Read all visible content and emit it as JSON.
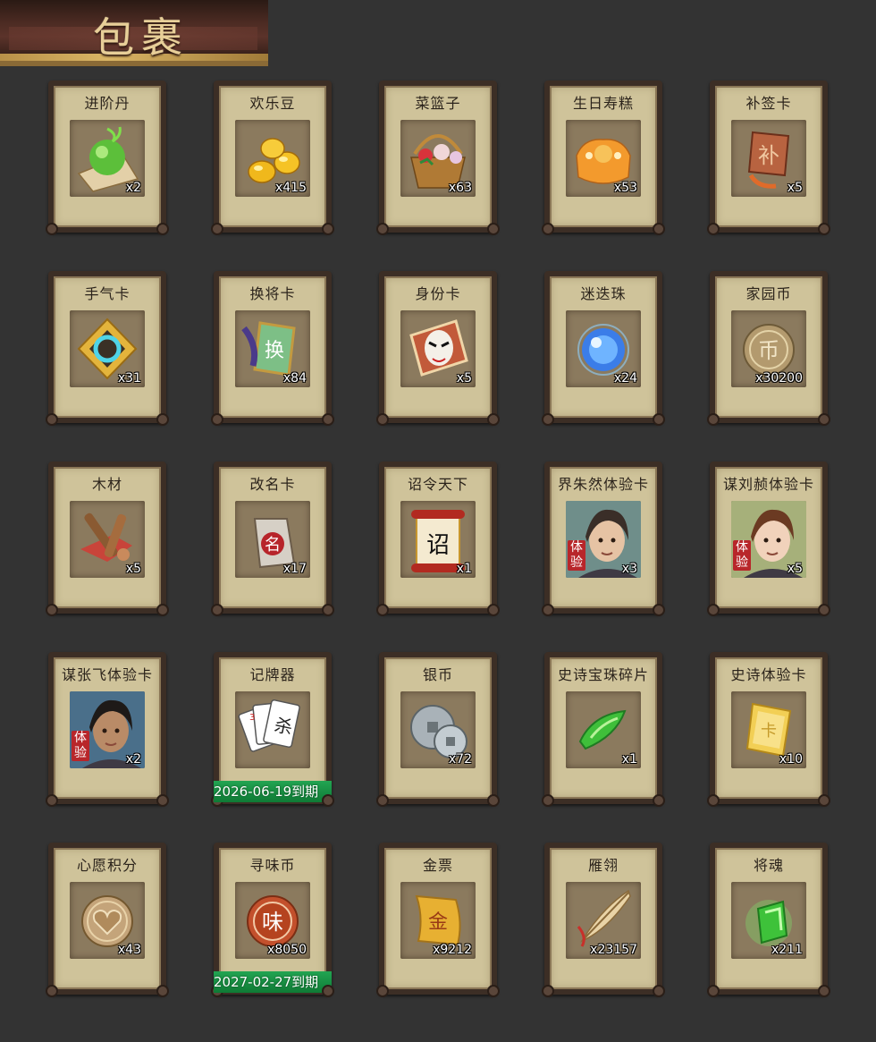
{
  "header": {
    "title": "包裹"
  },
  "items": [
    {
      "name": "进阶丹",
      "count": "x2",
      "icon": "green-orb-icon"
    },
    {
      "name": "欢乐豆",
      "count": "x415",
      "icon": "gold-beans-icon"
    },
    {
      "name": "菜篮子",
      "count": "x63",
      "icon": "flower-basket-icon"
    },
    {
      "name": "生日寿糕",
      "count": "x53",
      "icon": "birthday-cake-icon"
    },
    {
      "name": "补签卡",
      "count": "x5",
      "icon": "checkin-card-icon"
    },
    {
      "name": "手气卡",
      "count": "x31",
      "icon": "luck-card-icon"
    },
    {
      "name": "换将卡",
      "count": "x84",
      "icon": "swap-general-card-icon"
    },
    {
      "name": "身份卡",
      "count": "x5",
      "icon": "identity-mask-card-icon"
    },
    {
      "name": "迷迭珠",
      "count": "x24",
      "icon": "blue-pearl-icon"
    },
    {
      "name": "家园币",
      "count": "x30200",
      "icon": "home-coin-icon"
    },
    {
      "name": "木材",
      "count": "x5",
      "icon": "wood-icon"
    },
    {
      "name": "改名卡",
      "count": "x17",
      "icon": "rename-card-icon"
    },
    {
      "name": "诏令天下",
      "count": "x1",
      "icon": "edict-scroll-icon"
    },
    {
      "name": "界朱然体验卡",
      "count": "x3",
      "icon": "general-portrait-icon",
      "trial": "体验"
    },
    {
      "name": "谋刘赪体验卡",
      "count": "x5",
      "icon": "general-portrait-icon",
      "trial": "体验"
    },
    {
      "name": "谋张飞体验卡",
      "count": "x2",
      "icon": "general-portrait-icon",
      "trial": "体验"
    },
    {
      "name": "记牌器",
      "count": "",
      "icon": "playing-cards-icon",
      "expire": "2026-06-19到期"
    },
    {
      "name": "银币",
      "count": "x72",
      "icon": "silver-coin-icon"
    },
    {
      "name": "史诗宝珠碎片",
      "count": "x1",
      "icon": "green-shard-icon"
    },
    {
      "name": "史诗体验卡",
      "count": "x10",
      "icon": "gold-card-icon"
    },
    {
      "name": "心愿积分",
      "count": "x43",
      "icon": "heart-coin-icon"
    },
    {
      "name": "寻味币",
      "count": "x8050",
      "icon": "flavor-coin-icon",
      "expire": "2027-02-27到期"
    },
    {
      "name": "金票",
      "count": "x9212",
      "icon": "gold-ticket-icon"
    },
    {
      "name": "雁翎",
      "count": "x23157",
      "icon": "feather-icon"
    },
    {
      "name": "将魂",
      "count": "x211",
      "icon": "green-soul-crystal-icon"
    }
  ],
  "labels": {
    "icon_chars": {
      "checkin": "补",
      "swap": "换",
      "rename": "名",
      "edict": "诏",
      "cards": "杀",
      "flavor": "味",
      "gold_ticket": "金",
      "gold_card": "卡"
    }
  },
  "colors": {
    "background": "#333333",
    "card_face": "#cfc39a",
    "card_frame": "#3c2e25",
    "expire_green": "#1a9445",
    "trial_red": "#b8262a"
  }
}
